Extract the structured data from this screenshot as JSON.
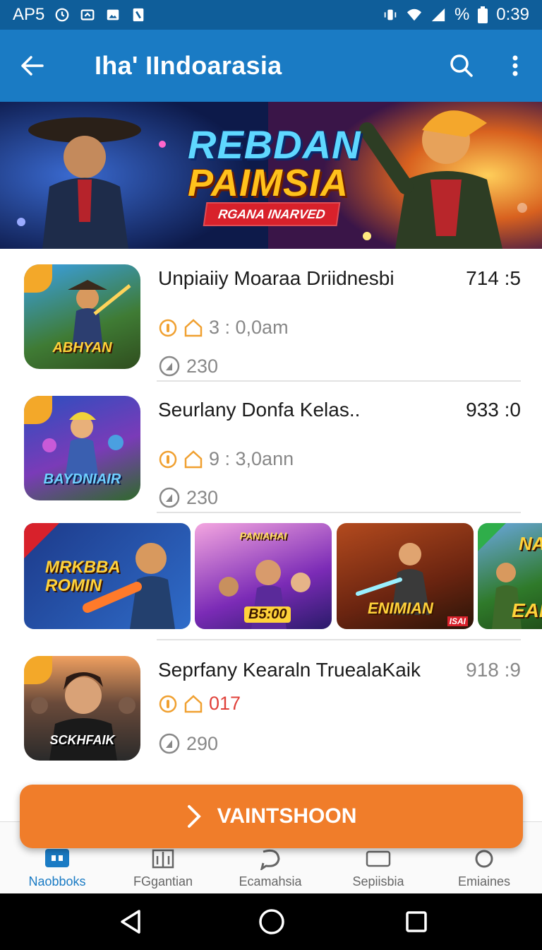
{
  "status_bar": {
    "carrier": "AP5",
    "battery": "%",
    "time": "0:39"
  },
  "app_bar": {
    "title": "Iha' IIndoarasia"
  },
  "banner": {
    "line1": "REBDAN",
    "line2": "PAIMSIA",
    "ribbon": "RGANA INARVED"
  },
  "games": [
    {
      "title": "Unpiaiiy Moaraa Driidnesbi",
      "score": "714 :5",
      "meta": "3 :  0,0am",
      "plays": "230",
      "thumb_label": "ABHYAN"
    },
    {
      "title": "Seurlany Donfa Kelas..",
      "score": "933 :0",
      "meta": "9 :  3,0ann",
      "plays": "230",
      "thumb_label": "BAYDNIAIR"
    },
    {
      "title": "Seprfany Kearaln TruealaKaik",
      "score": "918 :9",
      "meta": "017",
      "plays": "290",
      "thumb_label": "SCKHFAIK"
    }
  ],
  "carousel": [
    {
      "label": "MRKBBA ROMIN"
    },
    {
      "label": "B5:00",
      "sublabel": "PANIAHAI"
    },
    {
      "label": "ENIMIAN",
      "sublabel": "ISAI"
    },
    {
      "label": "EAH",
      "sublabel": "NA"
    }
  ],
  "cta": {
    "label": "VAINTSHOON"
  },
  "bottom_nav": [
    {
      "label": "Naobboks",
      "active": true
    },
    {
      "label": "FGgantian"
    },
    {
      "label": "Ecamahsia"
    },
    {
      "label": "Sepiisbia"
    },
    {
      "label": "Emiaines"
    }
  ],
  "colors": {
    "app_bar": "#1a7bc4",
    "status_bar": "#0f5e9a",
    "cta": "#f07d2a",
    "accent_warning": "#f0a030",
    "score_alert": "#e0413a"
  }
}
